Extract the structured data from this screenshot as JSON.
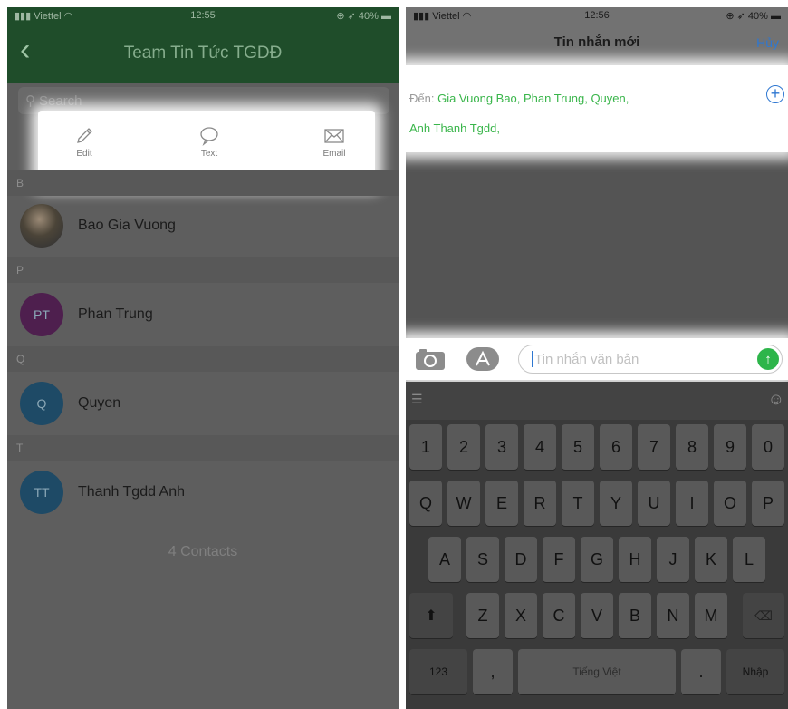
{
  "left": {
    "status": {
      "carrier": "Viettel",
      "time": "12:55",
      "battery": "40%"
    },
    "title": "Team Tin Tức TGDĐ",
    "back_icon": "chevron-left-icon",
    "search_placeholder": "Search",
    "actions": [
      {
        "label": "Edit",
        "icon": "pencil-icon"
      },
      {
        "label": "Text",
        "icon": "speech-bubble-icon"
      },
      {
        "label": "Email",
        "icon": "envelope-icon"
      }
    ],
    "sections": [
      "B",
      "P",
      "Q",
      "T"
    ],
    "contacts": [
      {
        "name": "Bao Gia Vuong",
        "initials": "",
        "avatar_color": ""
      },
      {
        "name": "Phan Trung",
        "initials": "PT",
        "avatar_color": "#4e1f4e"
      },
      {
        "name": "Quyen",
        "initials": "Q",
        "avatar_color": "#1e4a66"
      },
      {
        "name": "Thanh Tgdd Anh",
        "initials": "TT",
        "avatar_color": "#1e4a66"
      }
    ],
    "contacts_count": "4 Contacts"
  },
  "right": {
    "status": {
      "carrier": "Viettel",
      "time": "12:56",
      "battery": "40%"
    },
    "title": "Tin nhắn mới",
    "cancel": "Hủy",
    "to_label": "Đến:",
    "recipients_line1": "Gia Vuong Bao, Phan Trung, Quyen,",
    "recipients_line2": "Anh Thanh Tgdd,",
    "message_placeholder": "Tin nhắn văn bản",
    "keyboard": {
      "row_numbers": [
        "1",
        "2",
        "3",
        "4",
        "5",
        "6",
        "7",
        "8",
        "9",
        "0"
      ],
      "row_q": [
        "Q",
        "W",
        "E",
        "R",
        "T",
        "Y",
        "U",
        "I",
        "O",
        "P"
      ],
      "row_a": [
        "A",
        "S",
        "D",
        "F",
        "G",
        "H",
        "J",
        "K",
        "L"
      ],
      "row_z": [
        "Z",
        "X",
        "C",
        "V",
        "B",
        "N",
        "M"
      ],
      "key_123": "123",
      "key_comma": ",",
      "key_space": "Tiếng Việt",
      "key_period": ".",
      "key_return": "Nhập"
    }
  },
  "colors": {
    "accent_green": "#39b54a",
    "link_blue": "#2e77d1",
    "nav_green": "#1f4d2a"
  }
}
